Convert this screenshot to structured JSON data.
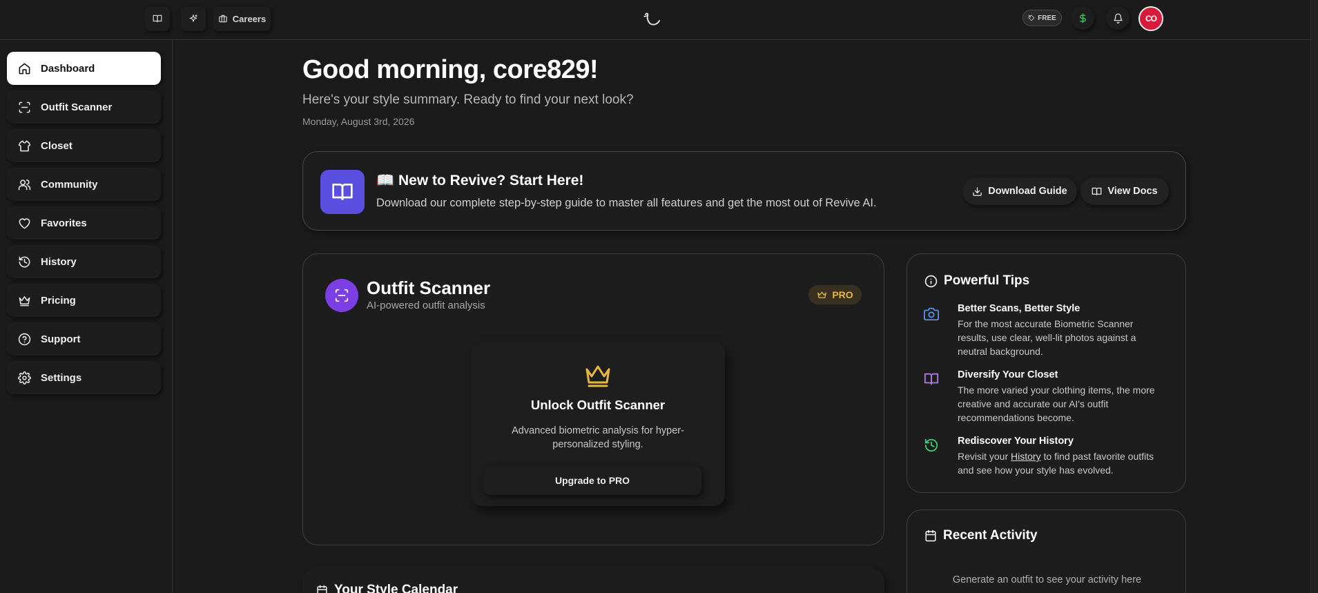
{
  "topbar": {
    "careers_label": "Careers",
    "plan_badge": "FREE",
    "avatar_initials": "CO",
    "accent_dollar": "#3ccf5a",
    "avatar_color": "#d81b3a"
  },
  "sidebar": {
    "items": [
      {
        "label": "Dashboard",
        "icon": "home-icon",
        "active": true
      },
      {
        "label": "Outfit Scanner",
        "icon": "scan-icon"
      },
      {
        "label": "Closet",
        "icon": "shirt-icon"
      },
      {
        "label": "Community",
        "icon": "users-icon"
      },
      {
        "label": "Favorites",
        "icon": "heart-icon"
      },
      {
        "label": "History",
        "icon": "history-icon"
      },
      {
        "label": "Pricing",
        "icon": "crown-icon"
      },
      {
        "label": "Support",
        "icon": "help-circle-icon"
      },
      {
        "label": "Settings",
        "icon": "gear-icon"
      }
    ]
  },
  "header": {
    "greeting": "Good morning, core829!",
    "subtitle": "Here's your style summary. Ready to find your next look?",
    "date": "Monday, August 3rd, 2026"
  },
  "banner": {
    "title": "📖 New to Revive? Start Here!",
    "description": "Download our complete step-by-step guide to master all features and get the most out of Revive AI.",
    "download_label": "Download Guide",
    "docs_label": "View Docs",
    "icon_color": "#5a4fe0"
  },
  "scanner": {
    "title": "Outfit Scanner",
    "subtitle": "AI-powered outfit analysis",
    "badge": "PRO",
    "unlock_title": "Unlock Outfit Scanner",
    "unlock_desc": "Advanced biometric analysis for hyper-personalized styling.",
    "upgrade_label": "Upgrade to PRO",
    "accent_color": "#e8b83a"
  },
  "tips": {
    "title": "Powerful Tips",
    "items": [
      {
        "title": "Better Scans, Better Style",
        "body": "For the most accurate Biometric Scanner results, use clear, well-lit photos against a neutral background.",
        "icon": "camera-icon",
        "color": "#5a8ff0"
      },
      {
        "title": "Diversify Your Closet",
        "body": "The more varied your clothing items, the more creative and accurate our AI's outfit recommendations become.",
        "icon": "book-open-icon",
        "color": "#b27ae8"
      },
      {
        "title": "Rediscover Your History",
        "body_pre": "Revisit your ",
        "body_link": "History",
        "body_post": " to find past favorite outfits and see how your style has evolved.",
        "icon": "history-icon",
        "color": "#3ccf7a"
      }
    ]
  },
  "activity": {
    "title": "Recent Activity",
    "empty": "Generate an outfit to see your activity here"
  },
  "calendar": {
    "title": "Your Style Calendar"
  }
}
